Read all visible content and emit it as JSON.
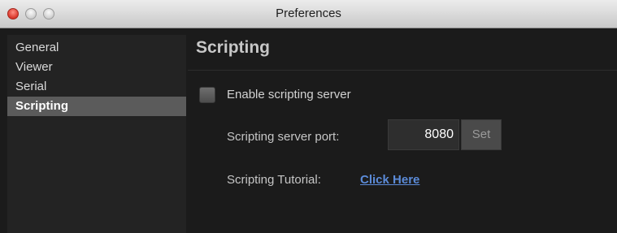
{
  "window": {
    "title": "Preferences"
  },
  "sidebar": {
    "items": [
      {
        "label": "General",
        "selected": false
      },
      {
        "label": "Viewer",
        "selected": false
      },
      {
        "label": "Serial",
        "selected": false
      },
      {
        "label": "Scripting",
        "selected": true
      }
    ]
  },
  "main": {
    "heading": "Scripting",
    "enable_server": {
      "label": "Enable scripting server",
      "checked": false
    },
    "port": {
      "label": "Scripting server port:",
      "value": "8080",
      "button_label": "Set"
    },
    "tutorial": {
      "label": "Scripting Tutorial:",
      "link_text": "Click Here"
    }
  },
  "colors": {
    "window_bg": "#1b1b1b",
    "selected_item_bg": "#5b5b5b",
    "link": "#5b8bd8",
    "close_button": "#d9362a"
  }
}
